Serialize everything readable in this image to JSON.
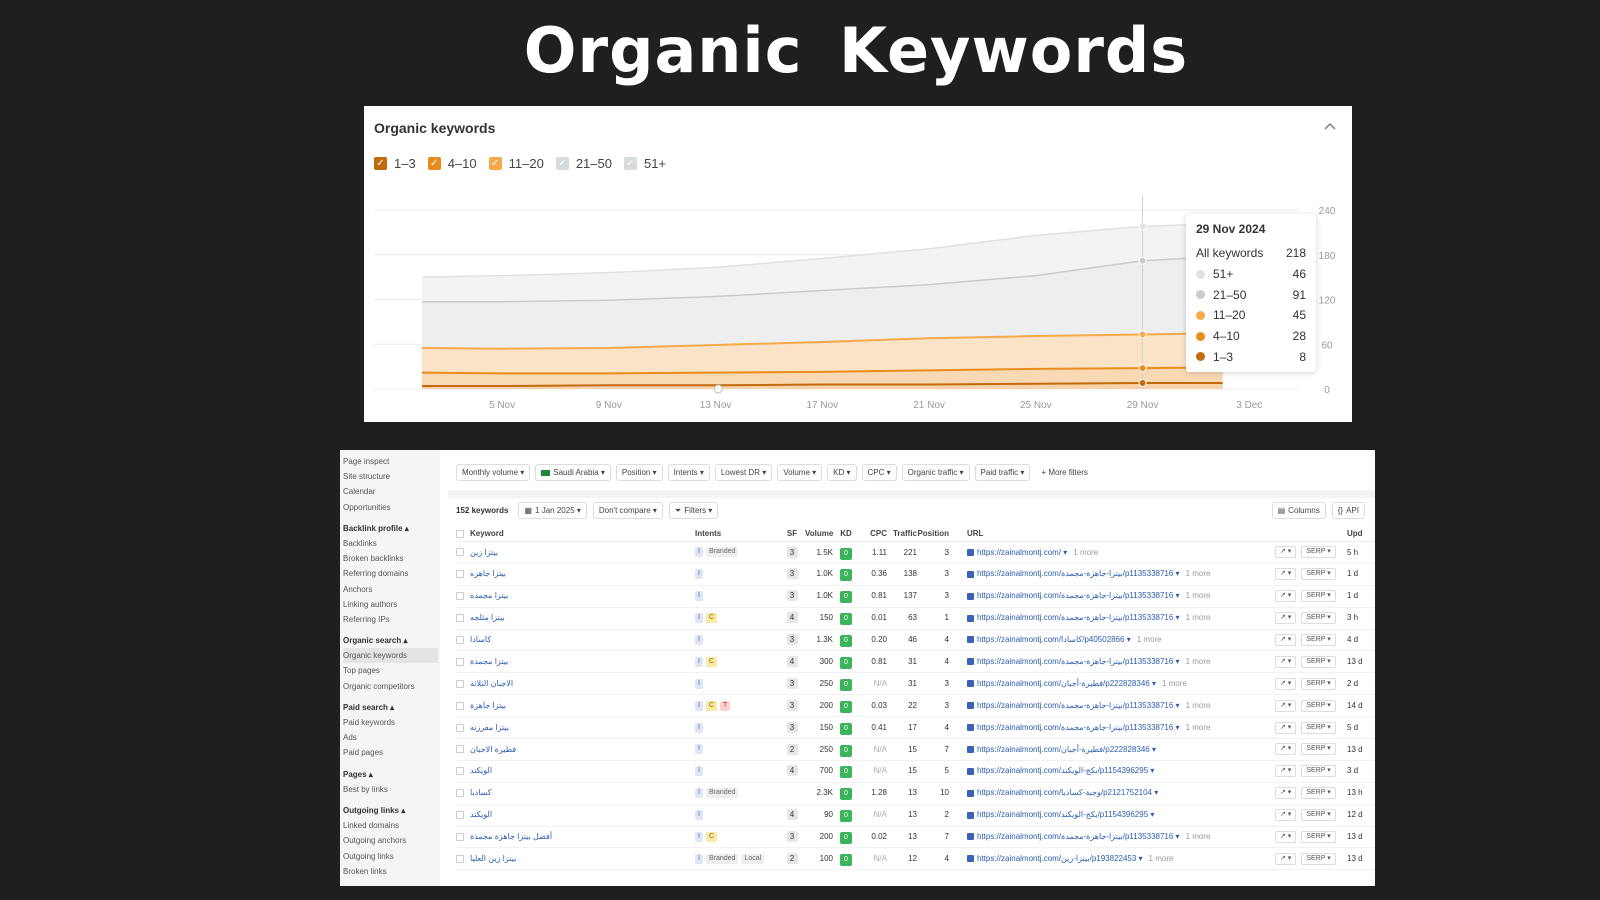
{
  "slide_title": "Organic  Keywords",
  "chart_panel": {
    "title": "Organic keywords",
    "legend": [
      {
        "label": "1–3",
        "checked": true,
        "color": "#c36a0c"
      },
      {
        "label": "4–10",
        "checked": true,
        "color": "#e88d1c"
      },
      {
        "label": "11–20",
        "checked": true,
        "color": "#f4a94a"
      },
      {
        "label": "21–50",
        "checked": false,
        "color": "#c8ccd1"
      },
      {
        "label": "51+",
        "checked": false,
        "color": "#dfe2e5"
      }
    ],
    "tooltip": {
      "date": "29 Nov 2024",
      "rows": [
        {
          "label": "All keywords",
          "value": "218",
          "color": ""
        },
        {
          "label": "51+",
          "value": "46",
          "color": "#dfe2e5"
        },
        {
          "label": "21–50",
          "value": "91",
          "color": "#c8ccd1"
        },
        {
          "label": "11–20",
          "value": "45",
          "color": "#f4a94a"
        },
        {
          "label": "4–10",
          "value": "28",
          "color": "#e88d1c"
        },
        {
          "label": "1–3",
          "value": "8",
          "color": "#c36a0c"
        }
      ]
    }
  },
  "chart_data": {
    "type": "area",
    "x_ticks": [
      "5 Nov",
      "9 Nov",
      "13 Nov",
      "17 Nov",
      "21 Nov",
      "25 Nov",
      "29 Nov",
      "3 Dec"
    ],
    "y_ticks": [
      "240",
      "180",
      "120",
      "60",
      "0"
    ],
    "ylim": [
      0,
      240
    ],
    "x_domain": [
      2,
      34
    ],
    "highlight_x": 29,
    "series_points_x": [
      2,
      5,
      9,
      13,
      17,
      21,
      25,
      29,
      32
    ],
    "series": [
      {
        "name": "1–3",
        "values": [
          4,
          4,
          5,
          5,
          6,
          6,
          7,
          8,
          8
        ],
        "color": "#c36a0c"
      },
      {
        "name": "4–10",
        "values": [
          22,
          21,
          21,
          22,
          23,
          25,
          27,
          28,
          29
        ],
        "color": "#e88d1c"
      },
      {
        "name": "11–20",
        "values": [
          55,
          54,
          55,
          59,
          63,
          68,
          71,
          73,
          75
        ],
        "color": "#f4a94a"
      },
      {
        "name": "21–50",
        "values": [
          117,
          117,
          119,
          124,
          132,
          140,
          152,
          172,
          178
        ],
        "color": "#c8ccd1"
      },
      {
        "name": "51+",
        "values": [
          150,
          152,
          156,
          163,
          175,
          188,
          206,
          218,
          222
        ],
        "color": "#dfe2e5"
      }
    ]
  },
  "sidebar": {
    "items": [
      {
        "label": "Page inspect",
        "type": "item"
      },
      {
        "label": "Site structure",
        "type": "item"
      },
      {
        "label": "Calendar",
        "type": "item"
      },
      {
        "label": "Opportunities",
        "type": "item"
      },
      {
        "label": "Backlink profile ▴",
        "type": "head"
      },
      {
        "label": "Backlinks",
        "type": "item"
      },
      {
        "label": "Broken backlinks",
        "type": "item"
      },
      {
        "label": "Referring domains",
        "type": "item"
      },
      {
        "label": "Anchors",
        "type": "item"
      },
      {
        "label": "Linking authors",
        "type": "item"
      },
      {
        "label": "Referring IPs",
        "type": "item"
      },
      {
        "label": "Organic search ▴",
        "type": "head"
      },
      {
        "label": "Organic keywords",
        "type": "active"
      },
      {
        "label": "Top pages",
        "type": "item"
      },
      {
        "label": "Organic competitors",
        "type": "item"
      },
      {
        "label": "Paid search ▴",
        "type": "head"
      },
      {
        "label": "Paid keywords",
        "type": "item"
      },
      {
        "label": "Ads",
        "type": "item"
      },
      {
        "label": "Paid pages",
        "type": "item"
      },
      {
        "label": "Pages ▴",
        "type": "head"
      },
      {
        "label": "Best by links",
        "type": "item"
      },
      {
        "label": "Outgoing links ▴",
        "type": "head"
      },
      {
        "label": "Linked domains",
        "type": "item"
      },
      {
        "label": "Outgoing anchors",
        "type": "item"
      },
      {
        "label": "Outgoing links",
        "type": "item"
      },
      {
        "label": "Broken links",
        "type": "item"
      }
    ]
  },
  "filters": [
    {
      "label": "Monthly volume ▾"
    },
    {
      "label": "Saudi Arabia ▾",
      "flag": true
    },
    {
      "label": "Position ▾"
    },
    {
      "label": "Intents ▾"
    },
    {
      "label": "Lowest DR ▾"
    },
    {
      "label": "Volume ▾"
    },
    {
      "label": "KD ▾"
    },
    {
      "label": "CPC ▾"
    },
    {
      "label": "Organic traffic ▾"
    },
    {
      "label": "Paid traffic ▾"
    },
    {
      "label": "+ More filters",
      "plain": true
    }
  ],
  "toolbar": {
    "keyword_count": "152 keywords",
    "date": "1 Jan 2025 ▾",
    "compare": "Don't compare ▾",
    "filters": "Filters ▾",
    "columns": "Columns",
    "api": "API"
  },
  "table": {
    "headers": {
      "keyword": "Keyword",
      "intents": "Intents",
      "sf": "SF",
      "volume": "Volume",
      "kd": "KD",
      "cpc": "CPC",
      "traffic": "Traffic",
      "position": "Position",
      "url": "URL",
      "updated": "Upd"
    },
    "serp_label": "SERP ▾",
    "trend_label": "↗ ▾",
    "rows": [
      {
        "kw": "بيتزا زين",
        "intents": [
          "I",
          "Branded"
        ],
        "sf": "3",
        "vol": "1.5K",
        "kd": "0",
        "cpc": "1.11",
        "traffic": "221",
        "pos": "3",
        "url": "https://zainalmontj.com/ ▾",
        "more": "1 more",
        "upd": "5 h"
      },
      {
        "kw": "بيتزا جاهزه",
        "intents": [
          "I"
        ],
        "sf": "3",
        "vol": "1.0K",
        "kd": "0",
        "cpc": "0.36",
        "traffic": "138",
        "pos": "3",
        "url": "https://zainalmontj.com/بيتزا-جاهزة-مجمدة/p1135338716 ▾",
        "more": "1 more",
        "upd": "1 d"
      },
      {
        "kw": "بيتزا مجمده",
        "intents": [
          "I"
        ],
        "sf": "3",
        "vol": "1.0K",
        "kd": "0",
        "cpc": "0.81",
        "traffic": "137",
        "pos": "3",
        "url": "https://zainalmontj.com/بيتزا-جاهزة-مجمدة/p1135338716 ▾",
        "more": "1 more",
        "upd": "1 d"
      },
      {
        "kw": "بيتزا مثلجه",
        "intents": [
          "I",
          "C"
        ],
        "sf": "4",
        "vol": "150",
        "kd": "0",
        "cpc": "0.01",
        "traffic": "63",
        "pos": "1",
        "url": "https://zainalmontj.com/بيتزا-جاهزة-مجمدة/p1135338716 ▾",
        "more": "1 more",
        "upd": "3 h"
      },
      {
        "kw": "كاسادا",
        "intents": [
          "I"
        ],
        "sf": "3",
        "vol": "1.3K",
        "kd": "0",
        "cpc": "0.20",
        "traffic": "46",
        "pos": "4",
        "url": "https://zainalmontj.com/كاسادا/p40502866 ▾",
        "more": "1 more",
        "upd": "4 d"
      },
      {
        "kw": "بيتزا مجمدة",
        "intents": [
          "I",
          "C"
        ],
        "sf": "4",
        "vol": "300",
        "kd": "0",
        "cpc": "0.81",
        "traffic": "31",
        "pos": "4",
        "url": "https://zainalmontj.com/بيتزا-جاهزة-مجمدة/p1135338716 ▾",
        "more": "1 more",
        "upd": "13 d"
      },
      {
        "kw": "الاجبان الثلاثه",
        "intents": [
          "I"
        ],
        "sf": "3",
        "vol": "250",
        "kd": "0",
        "cpc": "N/A",
        "traffic": "31",
        "pos": "3",
        "url": "https://zainalmontj.com/فطيرة-أجبان/p222828346 ▾",
        "more": "1 more",
        "upd": "2 d"
      },
      {
        "kw": "بيتزا جاهزة",
        "intents": [
          "I",
          "C",
          "T"
        ],
        "sf": "3",
        "vol": "200",
        "kd": "0",
        "cpc": "0.03",
        "traffic": "22",
        "pos": "3",
        "url": "https://zainalmontj.com/بيتزا-جاهزة-مجمدة/p1135338716 ▾",
        "more": "1 more",
        "upd": "14 d"
      },
      {
        "kw": "بيتزا مفرزنه",
        "intents": [
          "I"
        ],
        "sf": "3",
        "vol": "150",
        "kd": "0",
        "cpc": "0.41",
        "traffic": "17",
        "pos": "4",
        "url": "https://zainalmontj.com/بيتزا-جاهزة-مجمدة/p1135338716 ▾",
        "more": "1 more",
        "upd": "5 d"
      },
      {
        "kw": "فطيرة الاجبان",
        "intents": [
          "I"
        ],
        "sf": "2",
        "vol": "250",
        "kd": "0",
        "cpc": "N/A",
        "traffic": "15",
        "pos": "7",
        "url": "https://zainalmontj.com/فطيرة-أجبان/p222828346 ▾",
        "more": "",
        "upd": "13 d"
      },
      {
        "kw": "الويكند",
        "intents": [
          "I"
        ],
        "sf": "4",
        "vol": "700",
        "kd": "0",
        "cpc": "N/A",
        "traffic": "15",
        "pos": "5",
        "url": "https://zainalmontj.com/بكج-الويكند/p1154396295 ▾",
        "more": "",
        "upd": "3 d"
      },
      {
        "kw": "كسادبا",
        "intents": [
          "I",
          "Branded"
        ],
        "sf": "",
        "vol": "2.3K",
        "kd": "0",
        "cpc": "1.28",
        "traffic": "13",
        "pos": "10",
        "url": "https://zainalmontj.com/وجبة-كساديا/p2121752104 ▾",
        "more": "",
        "upd": "13 h"
      },
      {
        "kw": "الويكند",
        "intents": [
          "I"
        ],
        "sf": "4",
        "vol": "90",
        "kd": "0",
        "cpc": "N/A",
        "traffic": "13",
        "pos": "2",
        "url": "https://zainalmontj.com/بكج-الويكند/p1154396295 ▾",
        "more": "",
        "upd": "12 d"
      },
      {
        "kw": "أفضل بيتزا جاهزة مجمدة",
        "intents": [
          "I",
          "C"
        ],
        "sf": "3",
        "vol": "200",
        "kd": "0",
        "cpc": "0.02",
        "traffic": "13",
        "pos": "7",
        "url": "https://zainalmontj.com/بيتزا-جاهزة-مجمدة/p1135338716 ▾",
        "more": "1 more",
        "upd": "13 d"
      },
      {
        "kw": "بيتزا زين العليا",
        "intents": [
          "I",
          "Branded",
          "Local"
        ],
        "sf": "2",
        "vol": "100",
        "kd": "0",
        "cpc": "N/A",
        "traffic": "12",
        "pos": "4",
        "url": "https://zainalmontj.com/بيتزا-زين/p193822453 ▾",
        "more": "1 more",
        "upd": "13 d"
      }
    ]
  }
}
